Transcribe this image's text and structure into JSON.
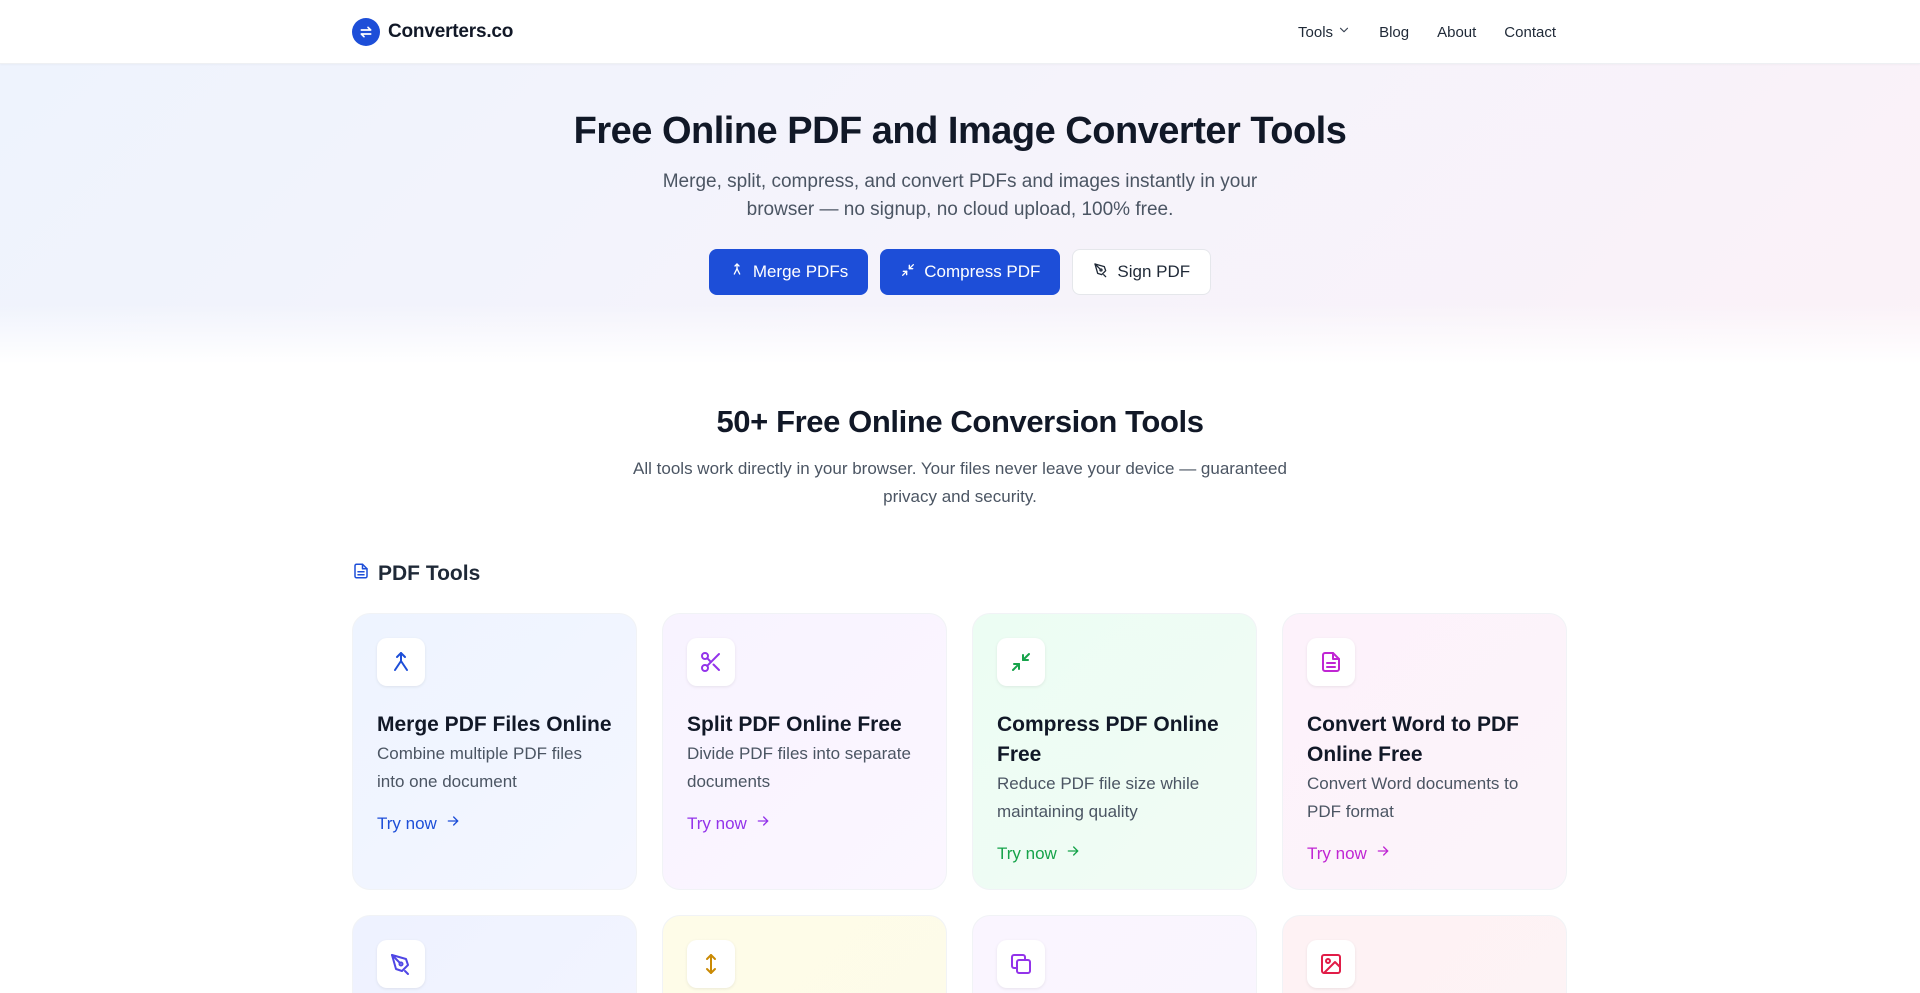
{
  "header": {
    "brand": "Converters.co",
    "nav": [
      {
        "label": "Tools"
      },
      {
        "label": "Blog"
      },
      {
        "label": "About"
      },
      {
        "label": "Contact"
      }
    ]
  },
  "hero": {
    "title": "Free Online PDF and Image Converter Tools",
    "subtitle": "Merge, split, compress, and convert PDFs and images instantly in your browser — no signup, no cloud upload, 100% free.",
    "buttons": [
      {
        "label": "Merge PDFs",
        "icon": "merge-icon"
      },
      {
        "label": "Compress PDF",
        "icon": "compress-icon"
      },
      {
        "label": "Sign PDF",
        "icon": "pen-icon"
      }
    ]
  },
  "tools_section": {
    "title": "50+ Free Online Conversion Tools",
    "subtitle": "All tools work directly in your browser. Your files never leave your device — guaranteed privacy and security.",
    "group_title": "PDF Tools",
    "link_label": "Try now",
    "cards": [
      {
        "title": "Merge PDF Files Online",
        "desc": "Combine multiple PDF files into one document",
        "icon": "merge-icon",
        "color": "#1d4ed8"
      },
      {
        "title": "Split PDF Online Free",
        "desc": "Divide PDF files into separate documents",
        "icon": "scissors-icon",
        "color": "#9333ea"
      },
      {
        "title": "Compress PDF Online Free",
        "desc": "Reduce PDF file size while maintaining quality",
        "icon": "compress-icon",
        "color": "#16a34a"
      },
      {
        "title": "Convert Word to PDF Online Free",
        "desc": "Convert Word documents to PDF format",
        "icon": "document-icon",
        "color": "#c026d3"
      },
      {
        "icon": "pen-icon",
        "color": "#4f46e5"
      },
      {
        "icon": "vertical-arrows-icon",
        "color": "#ca8a04"
      },
      {
        "icon": "copy-icon",
        "color": "#9333ea"
      },
      {
        "icon": "image-icon",
        "color": "#e11d48"
      }
    ]
  }
}
